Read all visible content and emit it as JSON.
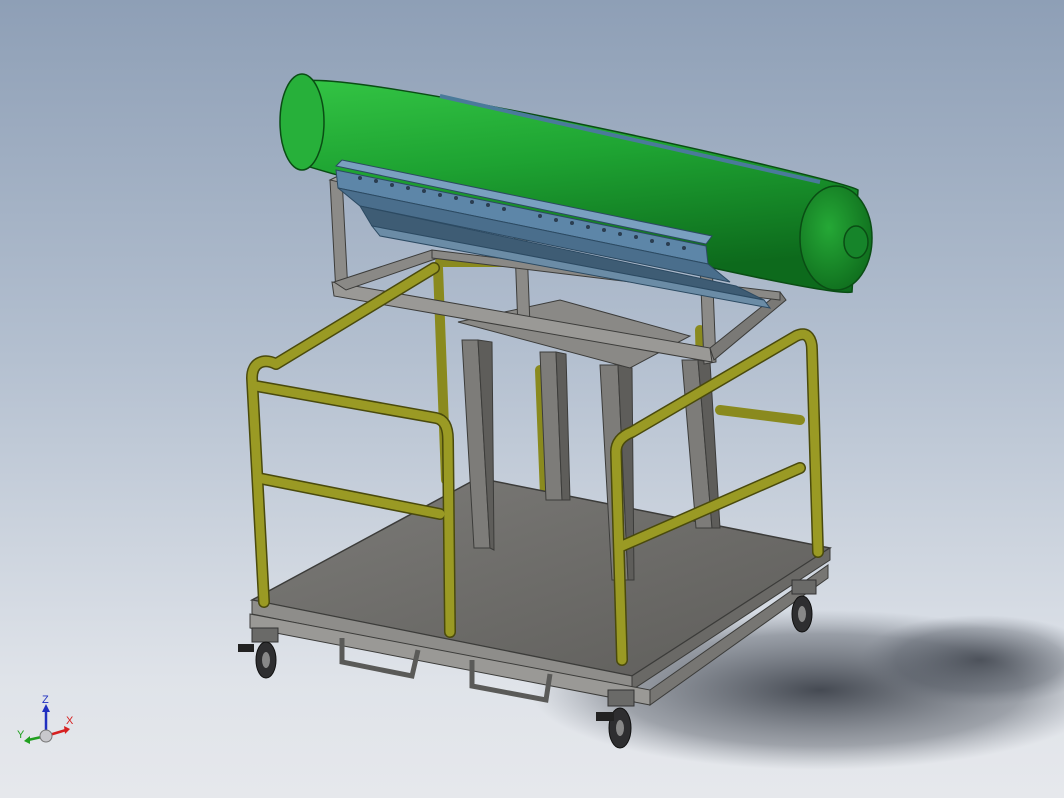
{
  "triad": {
    "x_label": "X",
    "y_label": "Y",
    "z_label": "Z"
  },
  "colors": {
    "background_top": "#8e9fb6",
    "background_bottom": "#e6e8ec",
    "tank_green": "#1a9c2c",
    "steel_gray": "#7a7a78",
    "railing_olive": "#8a8a1e",
    "rack_blue": "#5d86a8",
    "axis_x": "#d62020",
    "axis_y": "#20a020",
    "axis_z": "#2030c0"
  }
}
